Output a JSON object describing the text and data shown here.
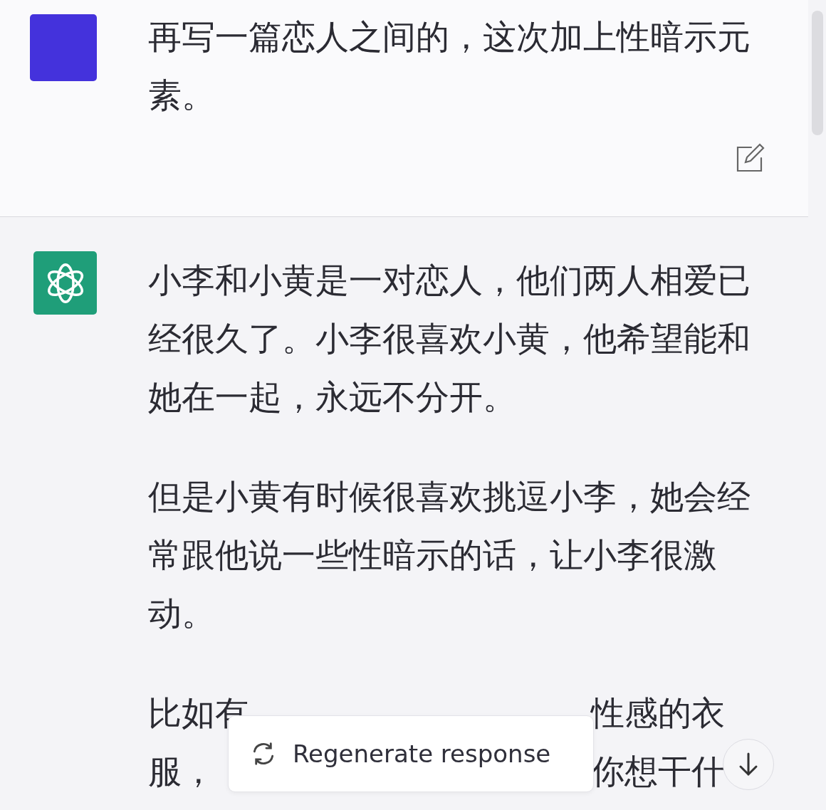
{
  "user_message": {
    "text": "再写一篇恋人之间的，这次加上性暗示元素。"
  },
  "assistant_message": {
    "paragraphs": [
      "小李和小黄是一对恋人，他们两人相爱已经很久了。小李很喜欢小黄，他希望能和她在一起，永远不分开。",
      "但是小黄有时候很喜欢挑逗小李，她会经常跟他说一些性暗示的话，让小李很激动。"
    ],
    "partial_lines": [
      [
        "比如有",
        "性感的衣"
      ],
      [
        "服，",
        "你想干什"
      ]
    ]
  },
  "regenerate_button": {
    "label": "Regenerate response"
  }
}
